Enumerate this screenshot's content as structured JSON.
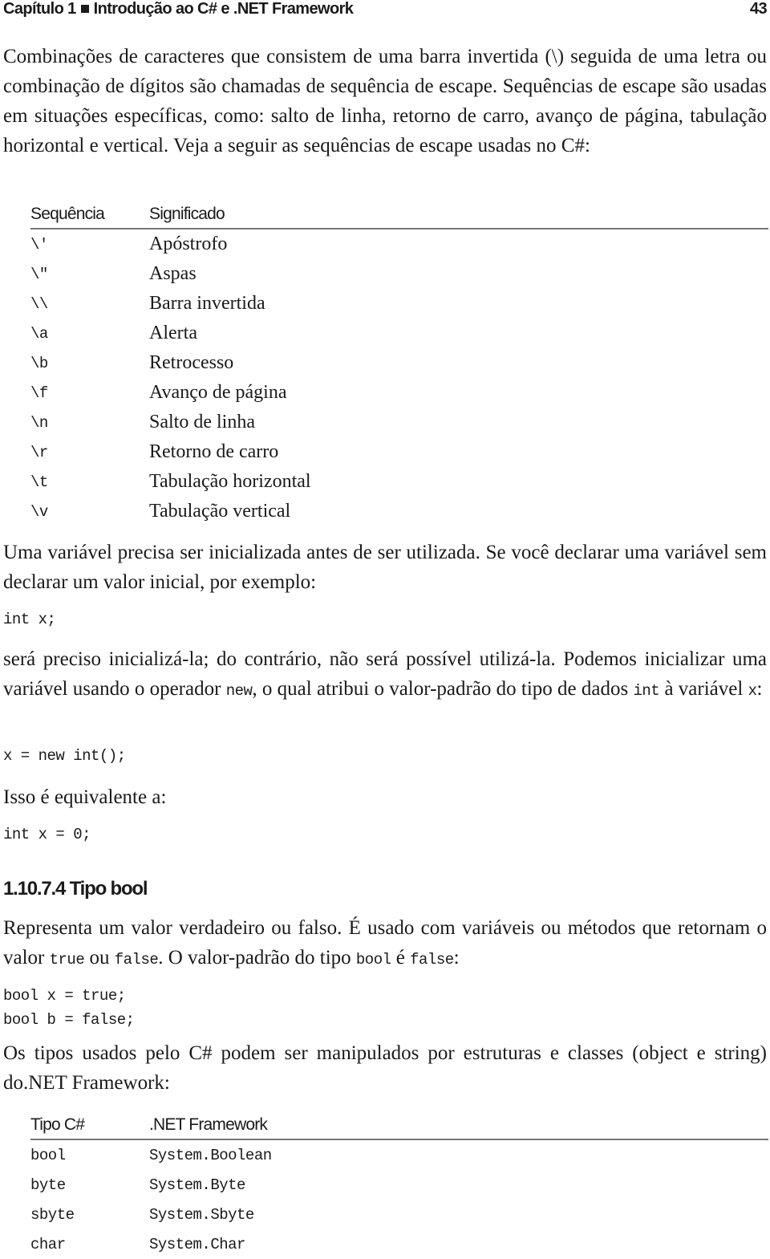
{
  "header": {
    "chapter": "Capítulo 1",
    "title": "Introdução ao C# e .NET Framework",
    "page_number": "43"
  },
  "paragraphs": {
    "p1": "Combinações de caracteres que consistem de uma barra invertida (\\) seguida de uma letra ou combinação de dígitos são chamadas de sequência de escape. Sequências de escape são usadas em situações específicas, como: salto de linha, retorno de carro, avanço de página, tabulação horizontal e vertical. Veja a seguir as sequências de escape usadas no C#:",
    "p2": "Uma variável precisa ser inicializada antes de ser utilizada. Se você declarar uma variável sem declarar um valor inicial, por exemplo:",
    "p3_a": "será preciso inicializá-la; do contrário, não será possível utilizá-la. Podemos inicializar uma variável usando o operador ",
    "p3_code1": "new",
    "p3_b": ", o qual atribui o valor-padrão do tipo de dados ",
    "p3_code2": "int",
    "p3_c": " à variável ",
    "p3_code3": "x",
    "p3_d": ":",
    "p4": "Isso é equivalente a:",
    "p5_a": "Representa um valor verdadeiro ou falso. É usado com variáveis ou métodos que retornam o valor ",
    "p5_code1": "true",
    "p5_b": " ou ",
    "p5_code2": "false",
    "p5_c": ". O valor-padrão do tipo ",
    "p5_code3": "bool",
    "p5_d": " é ",
    "p5_code4": "false",
    "p5_e": ":",
    "p6": "Os tipos usados pelo C# podem ser manipulados por estruturas e classes (object e string) do.NET Framework:"
  },
  "code": {
    "c1": "int x;",
    "c2": "x = new int();",
    "c3": "int x = 0;",
    "c4": "bool x = true;\nbool b = false;"
  },
  "section_heading": "1.10.7.4 Tipo bool",
  "escape_table": {
    "headers": [
      "Sequência",
      "Significado"
    ],
    "rows": [
      [
        "\\'",
        "Apóstrofo"
      ],
      [
        "\\\"",
        "Aspas"
      ],
      [
        "\\\\",
        "Barra invertida"
      ],
      [
        "\\a",
        "Alerta"
      ],
      [
        "\\b",
        "Retrocesso"
      ],
      [
        "\\f",
        "Avanço de página"
      ],
      [
        "\\n",
        "Salto de linha"
      ],
      [
        "\\r",
        "Retorno de carro"
      ],
      [
        "\\t",
        "Tabulação horizontal"
      ],
      [
        "\\v",
        "Tabulação vertical"
      ]
    ]
  },
  "types_table": {
    "headers": [
      "Tipo C#",
      ".NET Framework"
    ],
    "rows": [
      [
        "bool",
        "System.Boolean"
      ],
      [
        "byte",
        "System.Byte"
      ],
      [
        "sbyte",
        "System.Sbyte"
      ],
      [
        "char",
        "System.Char"
      ]
    ]
  }
}
